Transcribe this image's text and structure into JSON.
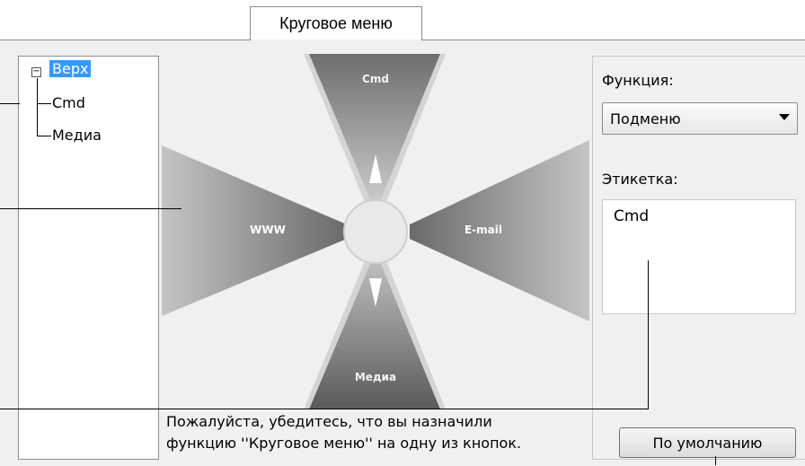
{
  "tab": {
    "label": "Круговое меню"
  },
  "tree": {
    "expander": "−",
    "items": [
      {
        "label": "Верх"
      },
      {
        "label": "Cmd"
      },
      {
        "label": "Медиа"
      }
    ]
  },
  "menu": {
    "top_label": "Cmd",
    "left_label": "WWW",
    "right_label": "E-mail",
    "bottom_label": "Медиа"
  },
  "function": {
    "label": "Функция:",
    "selected": "Подменю"
  },
  "caption": {
    "label": "Этикетка:",
    "value": "Cmd"
  },
  "info": {
    "line1": "Пожалуйста, убедитесь, что вы назначили",
    "line2": "функцию ''Круговое меню'' на одну из кнопок."
  },
  "default_button": {
    "label": "По умолчанию"
  }
}
